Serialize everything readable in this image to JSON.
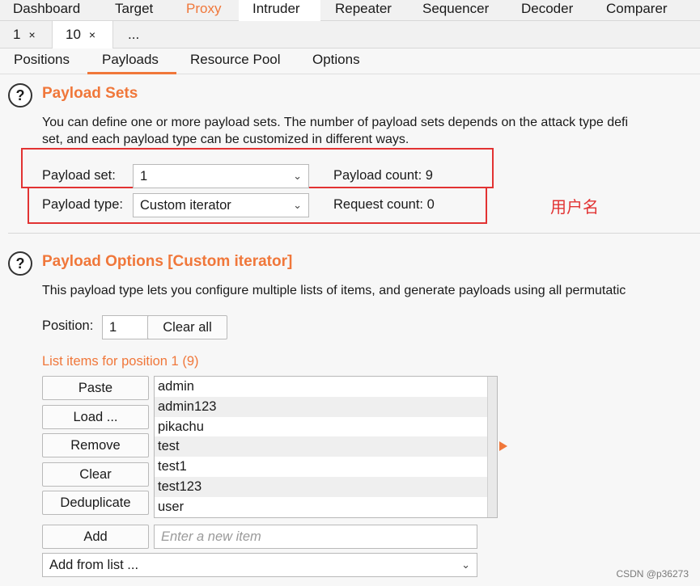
{
  "top_tabs": [
    "Dashboard",
    "Target",
    "Proxy",
    "Intruder",
    "Repeater",
    "Sequencer",
    "Decoder",
    "Comparer"
  ],
  "sub_tabs": [
    {
      "label": "1",
      "close": "×"
    },
    {
      "label": "10",
      "close": "×"
    },
    {
      "label": "..."
    }
  ],
  "config_tabs": [
    "Positions",
    "Payloads",
    "Resource Pool",
    "Options"
  ],
  "help_glyph": "?",
  "payload_sets": {
    "title": "Payload Sets",
    "desc1": "You can define one or more payload sets. The number of payload sets depends on the attack type defi",
    "desc2": "set, and each payload type can be customized in different ways.",
    "set_label": "Payload set:",
    "set_value": "1",
    "count_label": "Payload count: 9",
    "type_label": "Payload type:",
    "type_value": "Custom iterator",
    "request_label": "Request count: 0",
    "annotation": "用户名"
  },
  "payload_options": {
    "title": "Payload Options [Custom iterator]",
    "desc": "This payload type lets you configure multiple lists of items, and generate payloads using all permutatic",
    "position_label": "Position:",
    "position_value": "1",
    "clear_all": "Clear all",
    "list_title": "List items for position 1 (9)",
    "buttons": {
      "paste": "Paste",
      "load": "Load ...",
      "remove": "Remove",
      "clear": "Clear",
      "dedupe": "Deduplicate",
      "add": "Add"
    },
    "items": [
      "admin",
      "admin123",
      "pikachu",
      "test",
      "test1",
      "test123",
      "user"
    ],
    "new_item_placeholder": "Enter a new item",
    "add_from_list": "Add from list ..."
  },
  "icons": {
    "dropdown": "chevron-down-icon",
    "help": "help-icon",
    "close": "close-icon"
  },
  "colors": {
    "accent": "#f0773a",
    "annotation_red": "#e23333"
  },
  "watermark": "CSDN @p36273"
}
